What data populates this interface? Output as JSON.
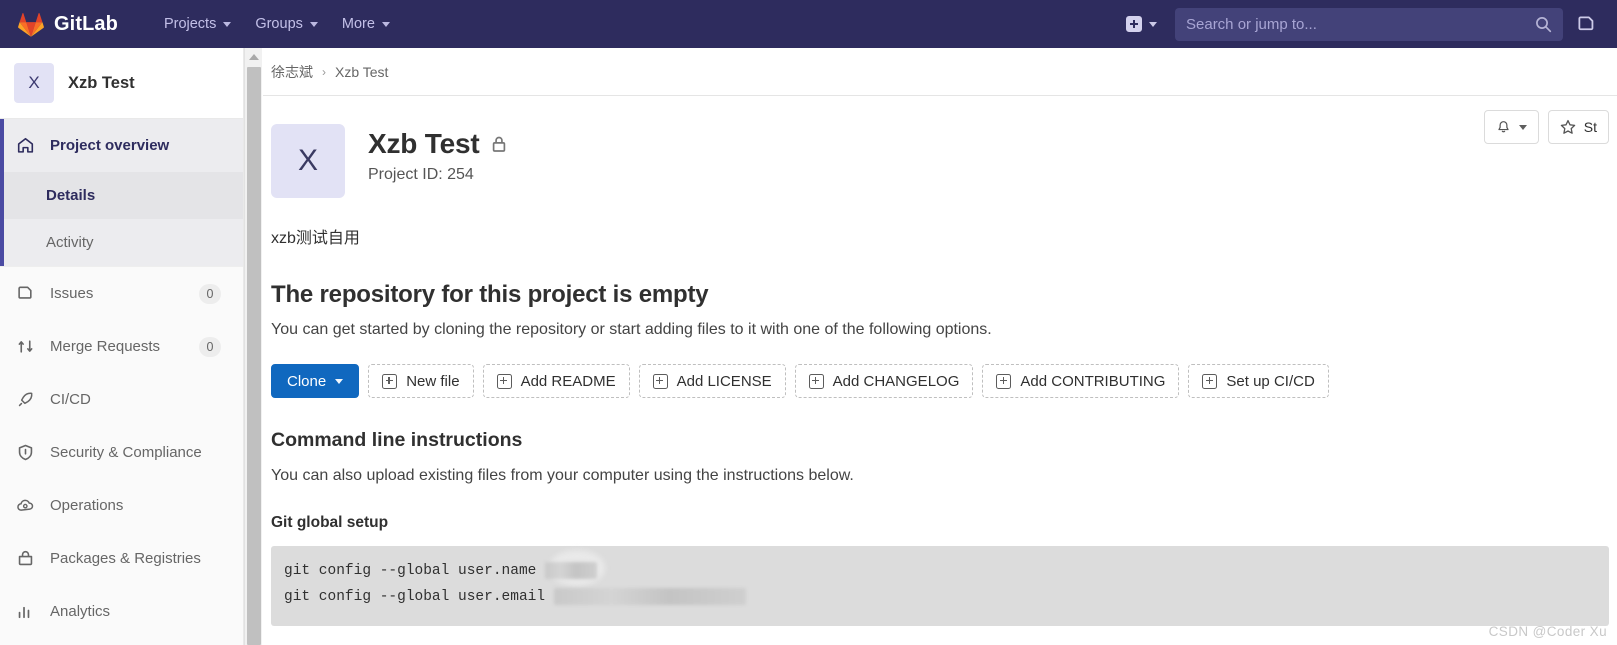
{
  "navbar": {
    "brand": "GitLab",
    "links": [
      {
        "label": "Projects",
        "name": "nav-projects"
      },
      {
        "label": "Groups",
        "name": "nav-groups"
      },
      {
        "label": "More",
        "name": "nav-more"
      }
    ],
    "create_icon": "plus-square-icon",
    "search_placeholder": "Search or jump to...",
    "search_value": "",
    "search_icon": "search-icon",
    "issues_icon": "issues-icon"
  },
  "sidebar": {
    "project_initial": "X",
    "project_name": "Xzb Test",
    "items": [
      {
        "label": "Project overview",
        "icon": "home-icon",
        "badge": "",
        "active": true
      },
      {
        "label": "Issues",
        "icon": "issues-icon",
        "badge": "0",
        "active": false
      },
      {
        "label": "Merge Requests",
        "icon": "merge-request-icon",
        "badge": "0",
        "active": false
      },
      {
        "label": "CI/CD",
        "icon": "rocket-icon",
        "badge": "",
        "active": false
      },
      {
        "label": "Security & Compliance",
        "icon": "shield-icon",
        "badge": "",
        "active": false
      },
      {
        "label": "Operations",
        "icon": "cloud-gear-icon",
        "badge": "",
        "active": false
      },
      {
        "label": "Packages & Registries",
        "icon": "package-icon",
        "badge": "",
        "active": false
      },
      {
        "label": "Analytics",
        "icon": "chart-icon",
        "badge": "",
        "active": false
      }
    ],
    "subitems": [
      {
        "label": "Details",
        "selected": true
      },
      {
        "label": "Activity",
        "selected": false
      }
    ]
  },
  "breadcrumb": {
    "group": "徐志斌",
    "separator": "›",
    "project": "Xzb Test"
  },
  "project": {
    "initial": "X",
    "title": "Xzb Test",
    "visibility_icon": "lock-icon",
    "id_label": "Project ID: 254",
    "description": "xzb测试自用"
  },
  "header_actions": {
    "notification_icon": "bell-icon",
    "star_label": "St",
    "star_icon": "star-icon"
  },
  "empty_repo": {
    "title": "The repository for this project is empty",
    "subtitle": "You can get started by cloning the repository or start adding files to it with one of the following options."
  },
  "actions": {
    "clone": "Clone",
    "buttons": [
      "New file",
      "Add README",
      "Add LICENSE",
      "Add CHANGELOG",
      "Add CONTRIBUTING",
      "Set up CI/CD"
    ]
  },
  "cli": {
    "title": "Command line instructions",
    "subtitle": "You can also upload existing files from your computer using the instructions below.",
    "section_title": "Git global setup",
    "code_lines": [
      "git config --global user.name ",
      "git config --global user.email "
    ]
  },
  "watermark": "CSDN @Coder Xu",
  "colors": {
    "navbar": "#2e2c5e",
    "primary": "#1068bf",
    "sidebar_accent": "#4b4ba3",
    "code_bg": "#dcdcdc"
  }
}
